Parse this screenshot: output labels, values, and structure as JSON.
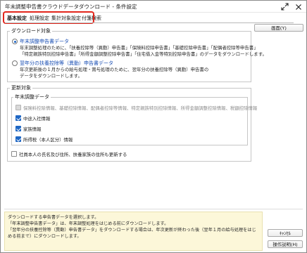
{
  "window": {
    "title": "年末調整申告書クラウドデータダウンロード - 条件設定",
    "maximize_icon": "expand-arrows-icon",
    "close_icon": "close-x-icon"
  },
  "tabs": [
    {
      "label": "基本設定",
      "active": true
    },
    {
      "label": "処理設定",
      "active": false
    },
    {
      "label": "集計対象設定",
      "active": false
    },
    {
      "label": "付箋検索",
      "active": false
    }
  ],
  "download_target": {
    "group_label": "ダウンロード対象",
    "option1": {
      "label": "年末調整申告書データ",
      "selected": true,
      "desc": [
        "年末調整処理のために、「扶養控除等（異動）申告書」「保険料控除申告書」「基礎控除申告書」「配偶者控除等申告書」",
        "「特定親族特別控除申告書」「所得金額調整控除申告書」「住宅借入金等特別控除申告書」のデータをダウンロードします。"
      ]
    },
    "option2": {
      "label": "翌年分の扶養控除等（異動）申告書データ",
      "selected": false,
      "desc": [
        "年次更新後の１月からの給与処理・賞与処理のために、翌年分の扶養控除等（異動）申告書の",
        "データをダウンロードします。"
      ]
    }
  },
  "update_target": {
    "group_label": "更新対象",
    "sub_label": "年末調整データ",
    "items": [
      {
        "label": "保険料控除情報、基礎控除情報、配偶者控除等情報、特定親族特別控除情報、所得金額調整控除情報、税額控除情報",
        "checked": false,
        "disabled": true
      },
      {
        "label": "中途入社情報",
        "checked": true,
        "disabled": false
      },
      {
        "label": "家族情報",
        "checked": true,
        "disabled": false
      },
      {
        "label": "所得税（本人区分）情報",
        "checked": true,
        "disabled": false
      }
    ],
    "address_option": {
      "label": "社員本人の氏名及び住所、扶養家族の住所も更新する",
      "checked": false
    }
  },
  "buttons": {
    "screen": "画面(Y)",
    "cancel": "ｷｬﾝｾﾙ",
    "help": "操作説明(H)"
  },
  "help_text": [
    "ダウンロードする申告書データを選択します。",
    "「年末調整申告書データ」は、年末調整処理をはじめる前にダウンロードします。",
    "「翌年分の扶養控除等（異動）申告書データ」をダウンロードする場合は、年次更新が終わった後（翌年１月の給与処理をはじ",
    "める前まで）にダウンロードします。"
  ]
}
